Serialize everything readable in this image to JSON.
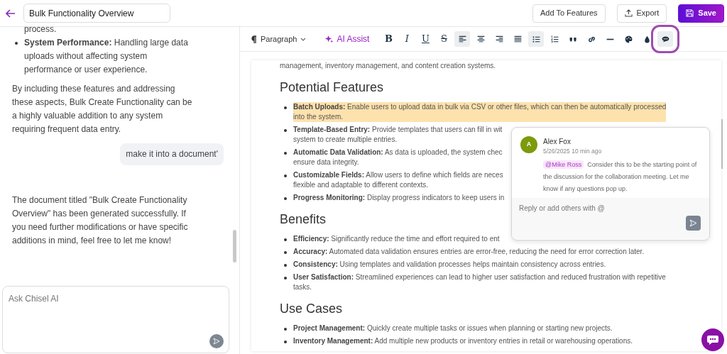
{
  "title_field": {
    "value": "Bulk Functionality Overview"
  },
  "header_buttons": [
    {
      "label": "Add To Features",
      "kind": "plain"
    },
    {
      "label": "Export",
      "kind": "export"
    },
    {
      "label": "Save",
      "kind": "primary"
    }
  ],
  "chat": {
    "messages": [
      {
        "kind": "assistant",
        "blocks": [
          {
            "kind": "continuation",
            "text": "process."
          },
          {
            "kind": "bullet",
            "label": "System Performance:",
            "text": "Handling large data uploads without affecting system performance or user experience."
          },
          {
            "kind": "paragraph",
            "text": "By including these features and addressing these aspects, Bulk Create Functionality can be a highly valuable addition to any system requiring frequent data entry."
          }
        ]
      },
      {
        "kind": "user",
        "text": "make it into a document'"
      },
      {
        "kind": "assistant",
        "blocks": [
          {
            "kind": "paragraph",
            "text": "The document titled \"Bulk Create Functionality Overview\" has been generated successfully. If you need further modifications or have specific additions in mind, feel free to let me know!"
          }
        ]
      }
    ],
    "input": {
      "placeholder": "Ask Chisel AI"
    }
  },
  "toolbar": {
    "block_style": "Paragraph",
    "ai_assist": "AI Assist",
    "tools": [
      {
        "text": "B",
        "selected": false,
        "outlined": false
      },
      {
        "text": "I",
        "selected": false,
        "outlined": false
      },
      {
        "text": "U",
        "selected": false,
        "outlined": false
      },
      {
        "text": "S",
        "selected": false,
        "outlined": false
      },
      {
        "selected": true,
        "outlined": false
      },
      {
        "selected": false,
        "outlined": false
      },
      {
        "selected": false,
        "outlined": false
      },
      {
        "selected": false,
        "outlined": false
      },
      {
        "selected": true,
        "outlined": false
      },
      {
        "selected": false,
        "outlined": false
      },
      {
        "selected": false,
        "outlined": false
      },
      {
        "selected": false,
        "outlined": false
      },
      {
        "selected": false,
        "outlined": false
      },
      {
        "selected": false,
        "outlined": false
      },
      {
        "selected": false,
        "outlined": false
      },
      {
        "selected": true,
        "outlined": true
      }
    ]
  },
  "document": {
    "lead": "management, inventory management, and content creation systems.",
    "sections": [
      {
        "heading": "Potential Features",
        "items": [
          {
            "label": "Batch Uploads:",
            "lines": [
              "Enable users to upload data in bulk via CSV or other files, which can then be automatically processed",
              "into the system."
            ],
            "highlighted": true
          },
          {
            "label": "Template-Based Entry:",
            "lines": [
              "Provide templates that users can fill in wit",
              "system to create multiple entries."
            ],
            "highlighted": false
          },
          {
            "label": "Automatic Data Validation:",
            "lines": [
              "As data is uploaded, the system chec",
              "ensure data integrity."
            ],
            "highlighted": false
          },
          {
            "label": "Customizable Fields:",
            "lines": [
              "Allow users to define which fields are neces",
              "flexible and adaptable to different contexts."
            ],
            "highlighted": false
          },
          {
            "label": "Progress Monitoring:",
            "lines": [
              "Display progress indicators to keep users in"
            ],
            "highlighted": false
          }
        ]
      },
      {
        "heading": "Benefits",
        "items": [
          {
            "label": "Efficiency:",
            "lines": [
              "Significantly reduce the time and effort required to ent"
            ],
            "highlighted": false
          },
          {
            "label": "Accuracy:",
            "lines": [
              "Automated data validation ensures entries are error-free, reducing the need for error correction later."
            ],
            "highlighted": false
          },
          {
            "label": "Consistency:",
            "lines": [
              "Using templates and validation processes helps maintain consistency across entries."
            ],
            "highlighted": false
          },
          {
            "label": "User Satisfaction:",
            "lines": [
              "Streamlined experiences can lead to higher user satisfaction and reduced frustration with repetitive",
              "tasks."
            ],
            "highlighted": false
          }
        ]
      },
      {
        "heading": "Use Cases",
        "items": [
          {
            "label": "Project Management:",
            "lines": [
              "Quickly create multiple tasks or issues when planning or starting new projects."
            ],
            "highlighted": false
          },
          {
            "label": "Inventory Management:",
            "lines": [
              "Add multiple new products or inventory entries in retail or warehousing operations."
            ],
            "highlighted": false
          }
        ]
      }
    ]
  },
  "comment": {
    "initial": "A",
    "author": "Alex Fox",
    "time": "5/26/2025 10 min ago",
    "mention": "@Mike Ross",
    "text": "Consider this to be the starting point of the discussion for the collaboration meeting. Let me know if any questions pop up.",
    "reply_placeholder": "Reply or add others with @"
  }
}
